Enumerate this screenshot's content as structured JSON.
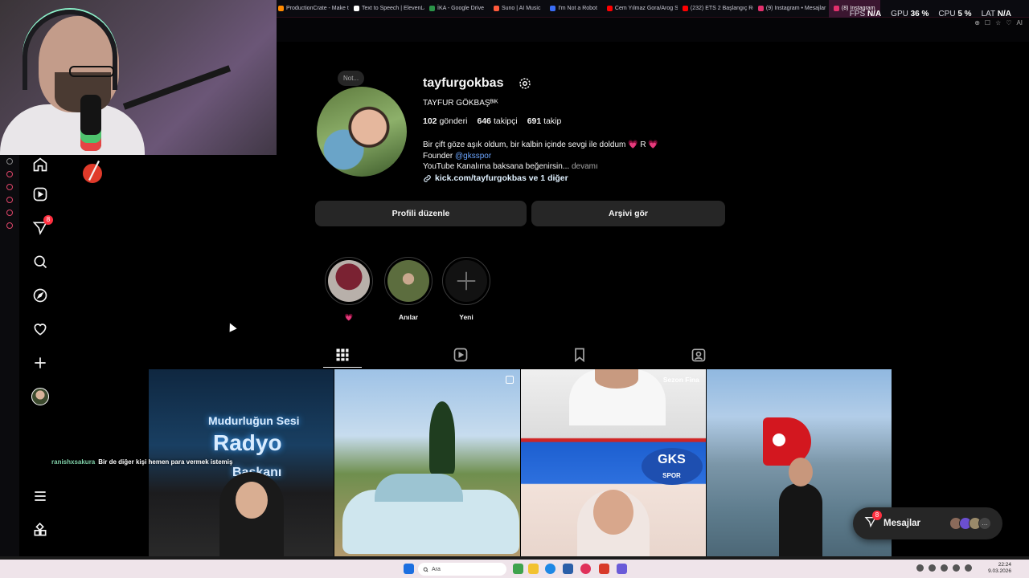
{
  "browser": {
    "tabs": [
      {
        "label": "ProductionCrate - Make t",
        "color": "#ff8a00",
        "active": false
      },
      {
        "label": "Text to Speech | ElevenLa",
        "color": "#ffffff",
        "active": false
      },
      {
        "label": "İKA - Google Drive",
        "color": "#2b9348",
        "active": false
      },
      {
        "label": "Suno | AI Music",
        "color": "#ff5a3c",
        "active": false
      },
      {
        "label": "I'm Not a Robot",
        "color": "#3a6cf4",
        "active": false
      },
      {
        "label": "Cem Yılmaz Gora/Arog S",
        "color": "#ff0000",
        "active": false
      },
      {
        "label": "(232) ETS 2 Başlangıç Re",
        "color": "#ff0000",
        "active": false
      },
      {
        "label": "(9) Instagram • Mesajlar",
        "color": "#e1306c",
        "active": false
      },
      {
        "label": "(8) Instagram",
        "color": "#e1306c",
        "active": true
      }
    ]
  },
  "stats": {
    "fps_label": "FPS",
    "fps_value": "N/A",
    "gpu_label": "GPU",
    "gpu_value": "36 %",
    "cpu_label": "CPU",
    "cpu_value": "5 %",
    "lat_label": "LAT",
    "lat_value": "N/A",
    "ai_label": "AI"
  },
  "nav": {
    "notification_badge": "8"
  },
  "profile": {
    "note": "Not...",
    "username": "tayfurgokbas",
    "full_name": "TAYFUR GÖKBAŞᴮᴵᴷ",
    "posts_count": "102",
    "posts_label": "gönderi",
    "followers_count": "646",
    "followers_label": "takipçi",
    "following_count": "691",
    "following_label": "takip",
    "bio_line1": "Bir çift göze aşık oldum, bir kalbin içinde sevgi ile doldum 💗 R 💗",
    "bio_founder": "Founder ",
    "bio_mention": "@gksspor",
    "bio_line3": "YouTube Kanalıma baksana beğenirsin...",
    "bio_more": " devamı",
    "link_text": "kick.com/tayfurgokbas ve 1 diğer",
    "edit_button": "Profili düzenle",
    "archive_button": "Arşivi gör"
  },
  "highlights": [
    {
      "label": "💗",
      "color": "#5a1a24"
    },
    {
      "label": "Anılar",
      "color": "#5c6d3e"
    },
    {
      "label": "Yeni",
      "color": "#0f0f0f"
    }
  ],
  "posts": {
    "post1_text_a": "Mudurluğun Sesi",
    "post1_text_b": "Radyo",
    "post1_text_c": "Başkanı",
    "post3_label": "Sezon Fina",
    "post3_logo": "GKS",
    "post3_logo_sub": "SPOR"
  },
  "overlay_comment": {
    "user": "ranishxsakura",
    "text": "Bir de diğer kişi hemen para vermek istemiş"
  },
  "messages": {
    "label": "Mesajlar",
    "badge": "8"
  },
  "taskbar": {
    "search_placeholder": "Ara",
    "time": "22:24",
    "date": "9.03.2026"
  }
}
